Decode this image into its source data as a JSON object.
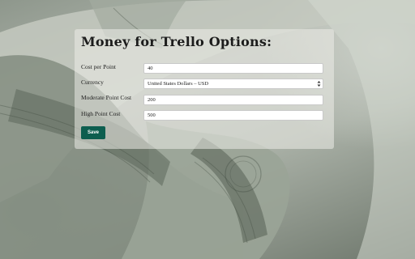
{
  "page": {
    "title": "Money for Trello Options:"
  },
  "form": {
    "cost_per_point": {
      "label": "Cost per Point",
      "value": "40"
    },
    "currency": {
      "label": "Currency",
      "selected": "United States Dollars – USD"
    },
    "moderate_point_cost": {
      "label": "Moderate Point Cost",
      "value": "200"
    },
    "high_point_cost": {
      "label": "High Point Cost",
      "value": "500"
    },
    "save_label": "Save"
  },
  "colors": {
    "accent": "#0d5e4f",
    "field_bg": "#ffffff",
    "text": "#1c1c1c"
  }
}
